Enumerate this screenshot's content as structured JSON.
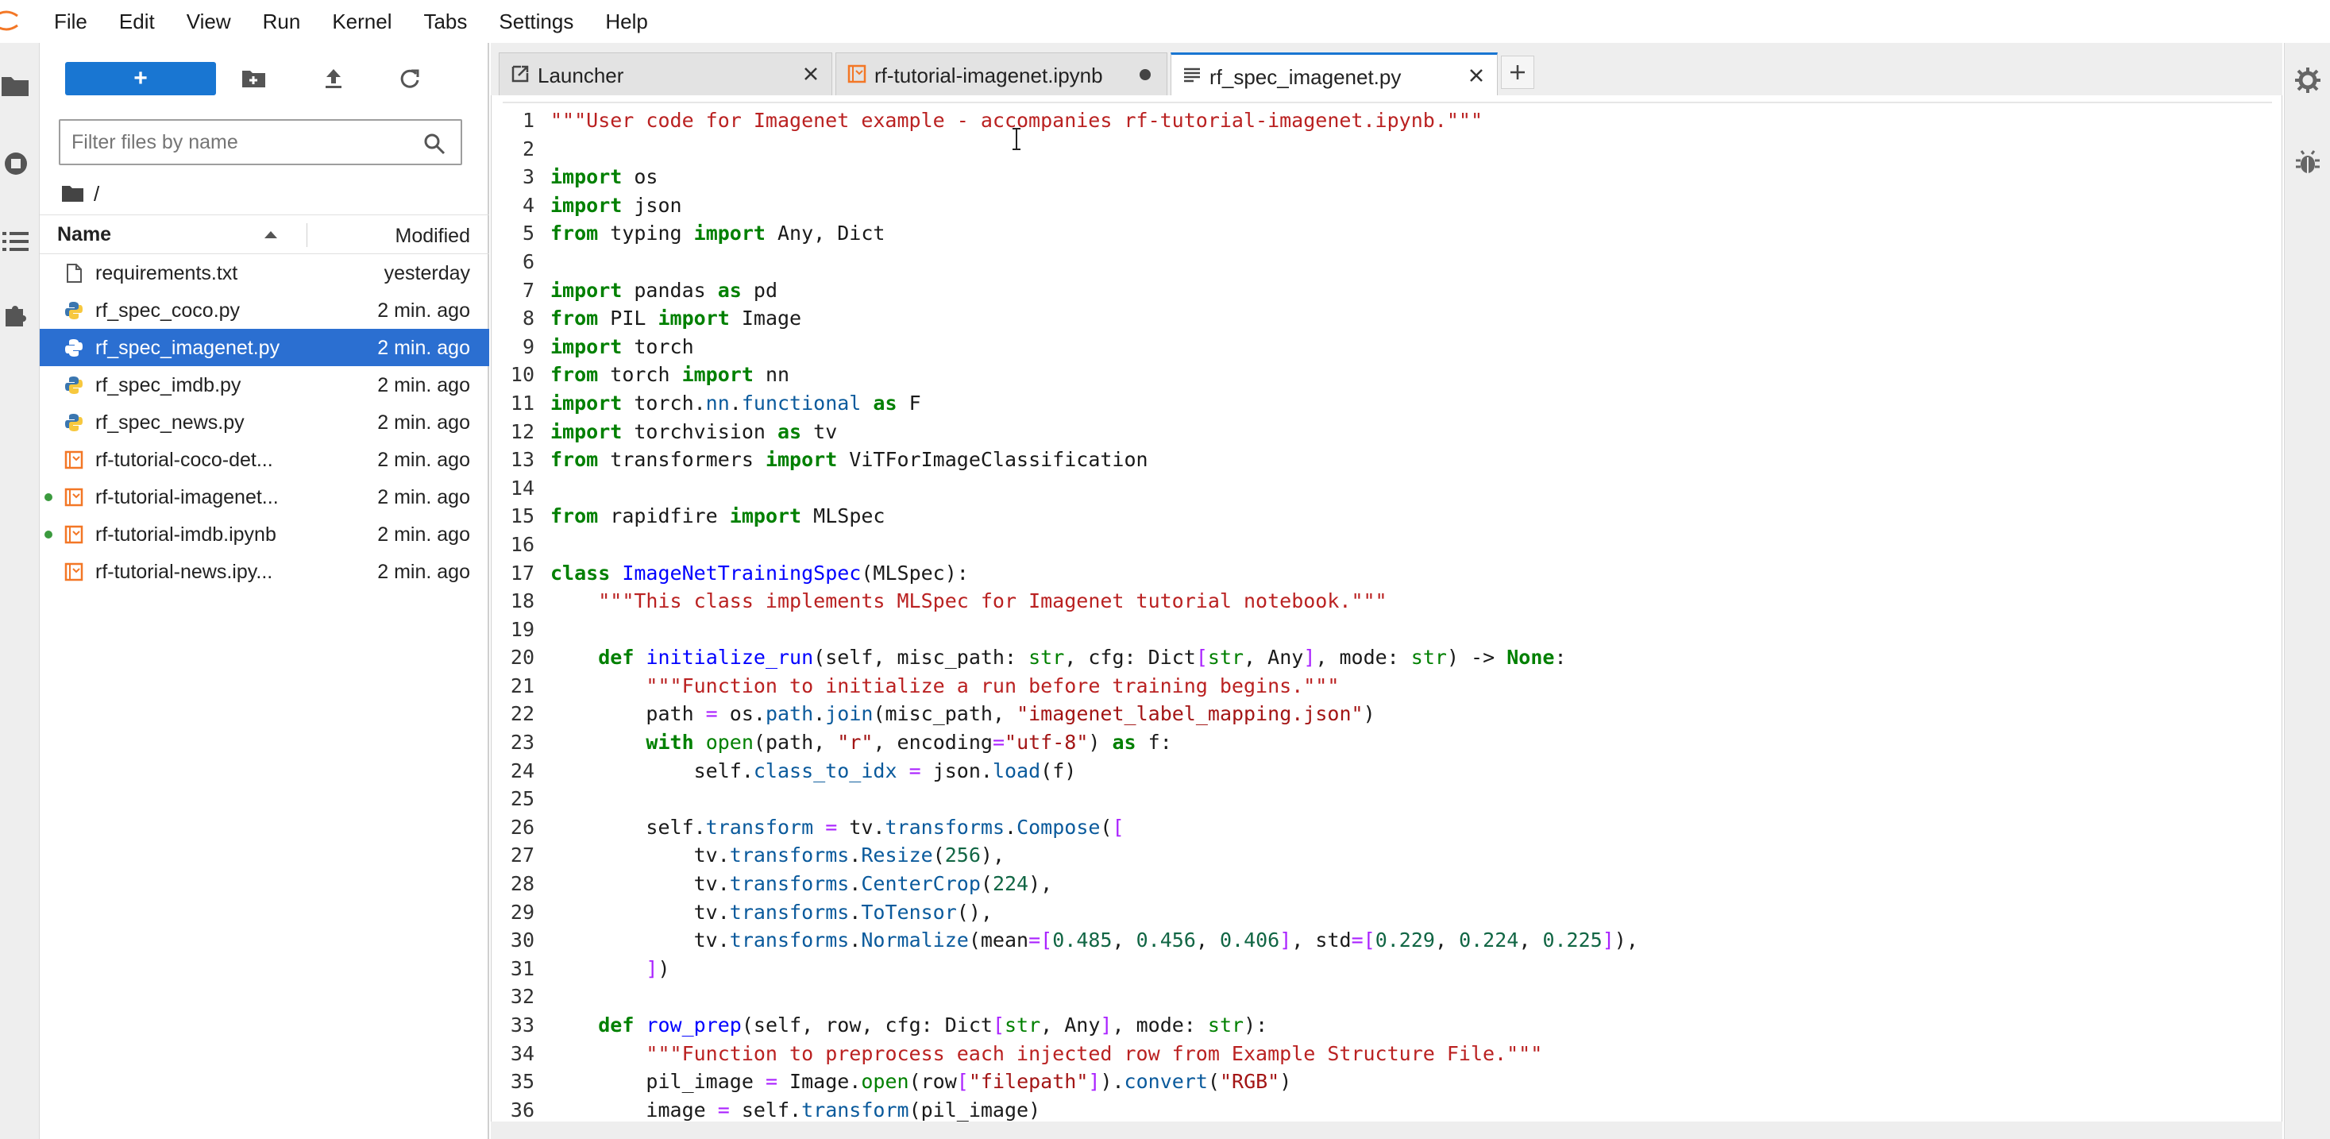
{
  "menubar": {
    "items": [
      "File",
      "Edit",
      "View",
      "Run",
      "Kernel",
      "Tabs",
      "Settings",
      "Help"
    ]
  },
  "filebrowser": {
    "new_button_label": "+",
    "filter_placeholder": "Filter files by name",
    "breadcrumb": "/",
    "columns": {
      "name": "Name",
      "modified": "Modified"
    },
    "files": [
      {
        "name": "requirements.txt",
        "modified": "yesterday",
        "type": "text",
        "running": false,
        "selected": false
      },
      {
        "name": "rf_spec_coco.py",
        "modified": "2 min. ago",
        "type": "python",
        "running": false,
        "selected": false
      },
      {
        "name": "rf_spec_imagenet.py",
        "modified": "2 min. ago",
        "type": "python",
        "running": false,
        "selected": true
      },
      {
        "name": "rf_spec_imdb.py",
        "modified": "2 min. ago",
        "type": "python",
        "running": false,
        "selected": false
      },
      {
        "name": "rf_spec_news.py",
        "modified": "2 min. ago",
        "type": "python",
        "running": false,
        "selected": false
      },
      {
        "name": "rf-tutorial-coco-det...",
        "modified": "2 min. ago",
        "type": "notebook",
        "running": false,
        "selected": false
      },
      {
        "name": "rf-tutorial-imagenet...",
        "modified": "2 min. ago",
        "type": "notebook",
        "running": true,
        "selected": false
      },
      {
        "name": "rf-tutorial-imdb.ipynb",
        "modified": "2 min. ago",
        "type": "notebook",
        "running": true,
        "selected": false
      },
      {
        "name": "rf-tutorial-news.ipy...",
        "modified": "2 min. ago",
        "type": "notebook",
        "running": false,
        "selected": false
      }
    ]
  },
  "tabs": [
    {
      "label": "Launcher",
      "icon": "launcher-icon",
      "active": false,
      "dirty": false
    },
    {
      "label": "rf-tutorial-imagenet.ipynb",
      "icon": "notebook-icon",
      "active": false,
      "dirty": true
    },
    {
      "label": "rf_spec_imagenet.py",
      "icon": "text-file-icon",
      "active": true,
      "dirty": false
    }
  ],
  "editor": {
    "lines": [
      "\"\"\"User code for Imagenet example - accompanies rf-tutorial-imagenet.ipynb.\"\"\"",
      "",
      "import os",
      "import json",
      "from typing import Any, Dict",
      "",
      "import pandas as pd",
      "from PIL import Image",
      "import torch",
      "from torch import nn",
      "import torch.nn.functional as F",
      "import torchvision as tv",
      "from transformers import ViTForImageClassification",
      "",
      "from rapidfire import MLSpec",
      "",
      "class ImageNetTrainingSpec(MLSpec):",
      "    \"\"\"This class implements MLSpec for Imagenet tutorial notebook.\"\"\"",
      "",
      "    def initialize_run(self, misc_path: str, cfg: Dict[str, Any], mode: str) -> None:",
      "        \"\"\"Function to initialize a run before training begins.\"\"\"",
      "        path = os.path.join(misc_path, \"imagenet_label_mapping.json\")",
      "        with open(path, \"r\", encoding=\"utf-8\") as f:",
      "            self.class_to_idx = json.load(f)",
      "",
      "        self.transform = tv.transforms.Compose([",
      "            tv.transforms.Resize(256),",
      "            tv.transforms.CenterCrop(224),",
      "            tv.transforms.ToTensor(),",
      "            tv.transforms.Normalize(mean=[0.485, 0.456, 0.406], std=[0.229, 0.224, 0.225]),",
      "        ])",
      "",
      "    def row_prep(self, row, cfg: Dict[str, Any], mode: str):",
      "        \"\"\"Function to preprocess each injected row from Example Structure File.\"\"\"",
      "        pil_image = Image.open(row[\"filepath\"]).convert(\"RGB\")",
      "        image = self.transform(pil_image)"
    ]
  }
}
